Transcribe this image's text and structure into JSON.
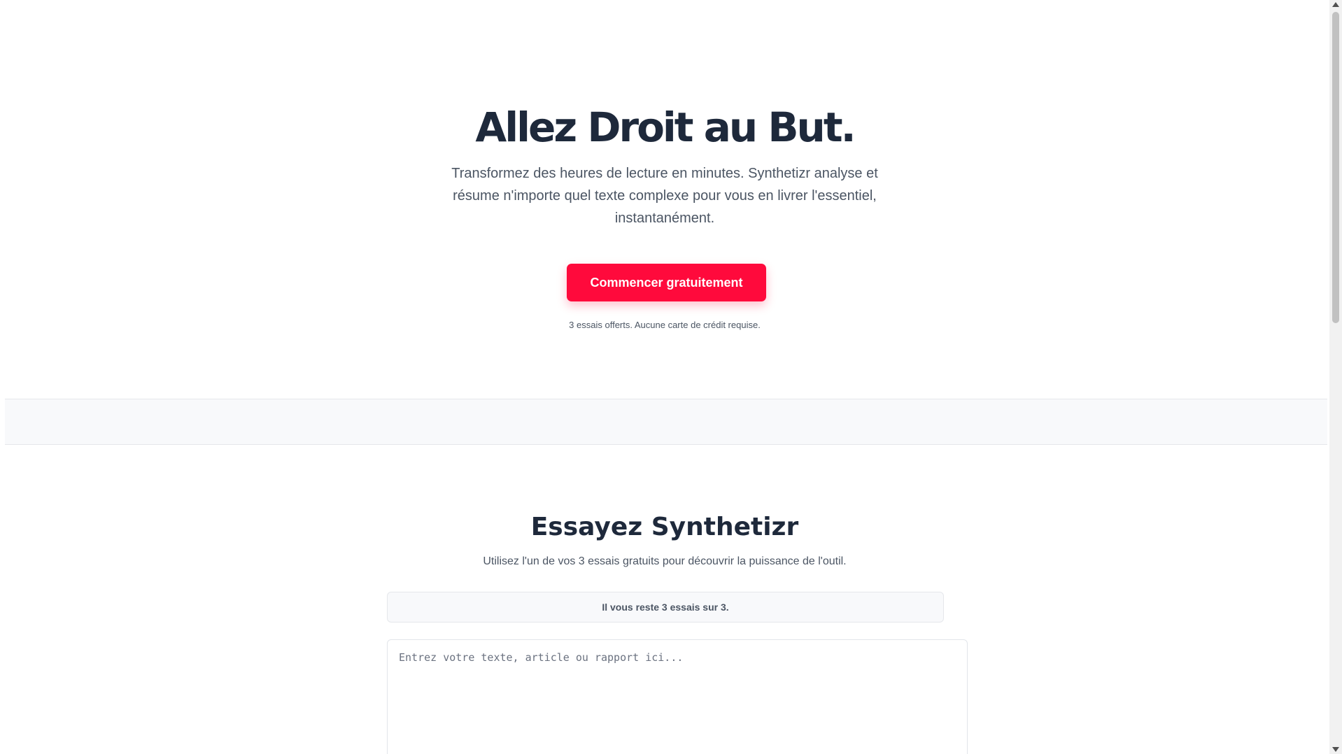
{
  "hero": {
    "title": "Allez Droit au But.",
    "subtitle": "Transformez des heures de lecture en minutes. Synthetizr analyse et résume n'importe quel texte complexe pour vous en livrer l'essentiel, instantanément.",
    "cta_label": "Commencer gratuitement",
    "note": "3 essais offerts. Aucune carte de crédit requise."
  },
  "try_section": {
    "title": "Essayez Synthetizr",
    "subtitle": "Utilisez l'un de vos 3 essais gratuits pour découvrir la puissance de l'outil.",
    "trials_remaining": "Il vous reste 3 essais sur 3.",
    "input": {
      "value": "",
      "placeholder": "Entrez votre texte, article ou rapport ici..."
    }
  },
  "colors": {
    "accent": "#ff0a3c",
    "heading": "#1e293b",
    "body_text": "#4b5563",
    "band_background": "#f8f9fb"
  },
  "icons": {
    "scroll_up": "chevron-up-icon",
    "scroll_down": "chevron-down-icon"
  }
}
